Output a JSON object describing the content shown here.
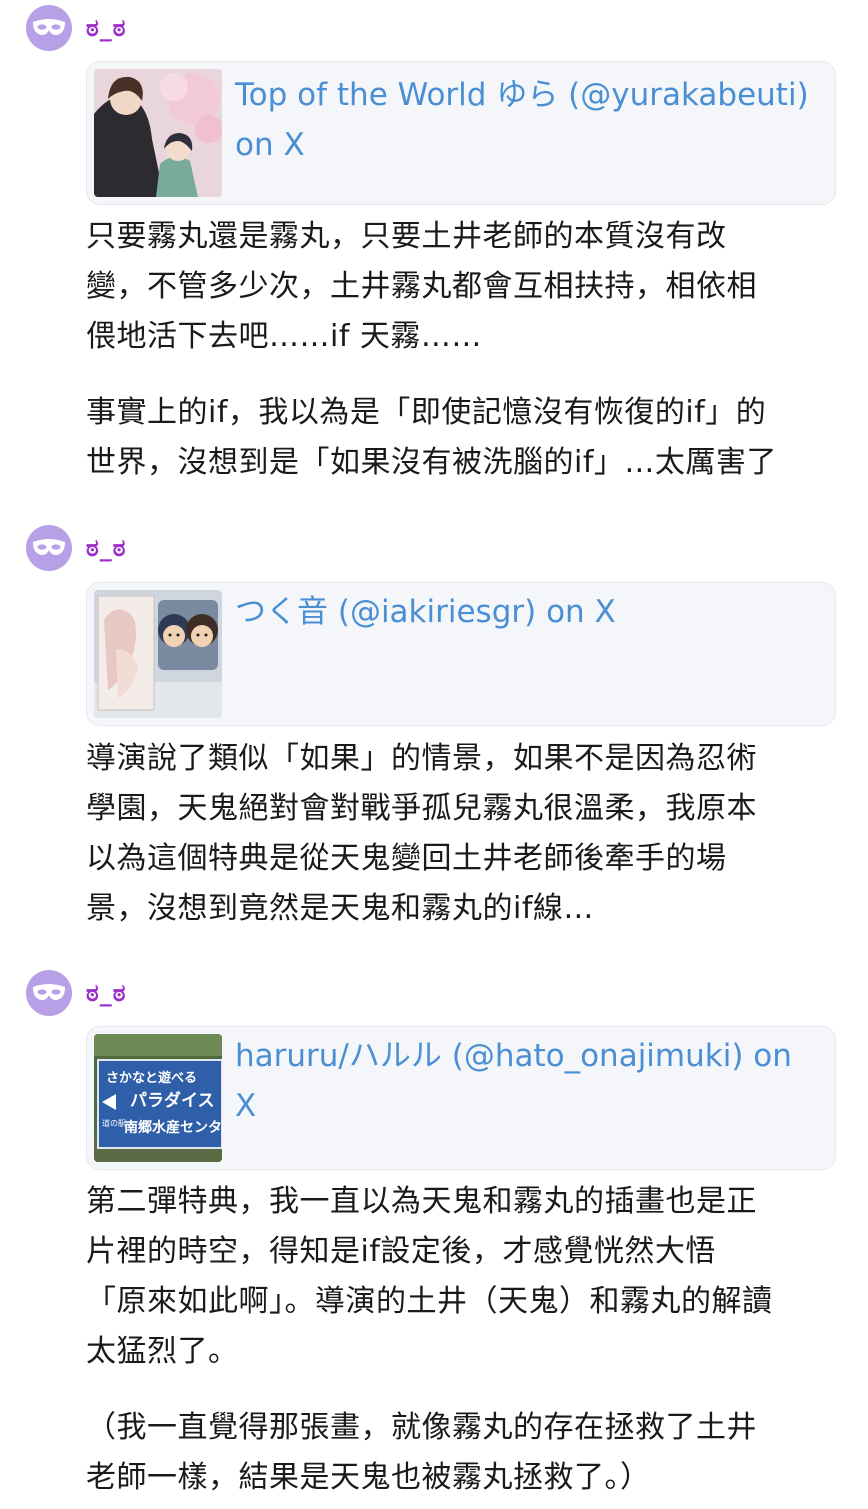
{
  "posts": [
    {
      "username": "ಠ_ಠ",
      "card": {
        "title_line1": "Top of the World ゆら (@yurakabeuti)",
        "title_line2": "on X"
      },
      "paragraphs": [
        [
          "只要霧丸還是霧丸，只要土井老師的本質沒有改",
          "變，不管多少次，土井霧丸都會互相扶持，相依相",
          "偎地活下去吧……if 天霧……"
        ],
        [
          "事實上的if，我以為是「即使記憶沒有恢復的if」的",
          "世界，沒想到是「如果沒有被洗腦的if」…太厲害了"
        ]
      ]
    },
    {
      "username": "ಠ_ಠ",
      "card": {
        "title_line1": "つく音 (@iakiriesgr) on X",
        "title_line2": ""
      },
      "paragraphs": [
        [
          "導演說了類似「如果」的情景，如果不是因為忍術",
          "學園，天鬼絕對會對戰爭孤兒霧丸很溫柔，我原本",
          "以為這個特典是從天鬼變回土井老師後牽手的場",
          "景，沒想到竟然是天鬼和霧丸的if線…"
        ]
      ]
    },
    {
      "username": "ಠ_ಠ",
      "card": {
        "title_line1": "haruru/ハルル (@hato_onajimuki) on X",
        "title_line2": ""
      },
      "thumb_sign": {
        "line1": "さかなと遊べる",
        "line2": "パラダイス",
        "line3": "南郷水産センター",
        "line4": "道の駅"
      },
      "paragraphs": [
        [
          "第二彈特典，我一直以為天鬼和霧丸的插畫也是正",
          "片裡的時空，得知是if設定後，才感覺恍然大悟",
          "「原來如此啊」。導演的土井（天鬼）和霧丸的解讀",
          "太猛烈了。"
        ],
        [
          "（我一直覺得那張畫，就像霧丸的存在拯救了土井",
          "老師一樣，結果是天鬼也被霧丸拯救了。）"
        ]
      ]
    }
  ],
  "colors": {
    "username": "#9b30c8",
    "avatar_bg": "#b8a0e6",
    "link": "#4a8fd4",
    "card_bg": "#f5f6f9",
    "text": "#1a1a1a"
  },
  "icons": {
    "avatar": "mask-icon"
  }
}
